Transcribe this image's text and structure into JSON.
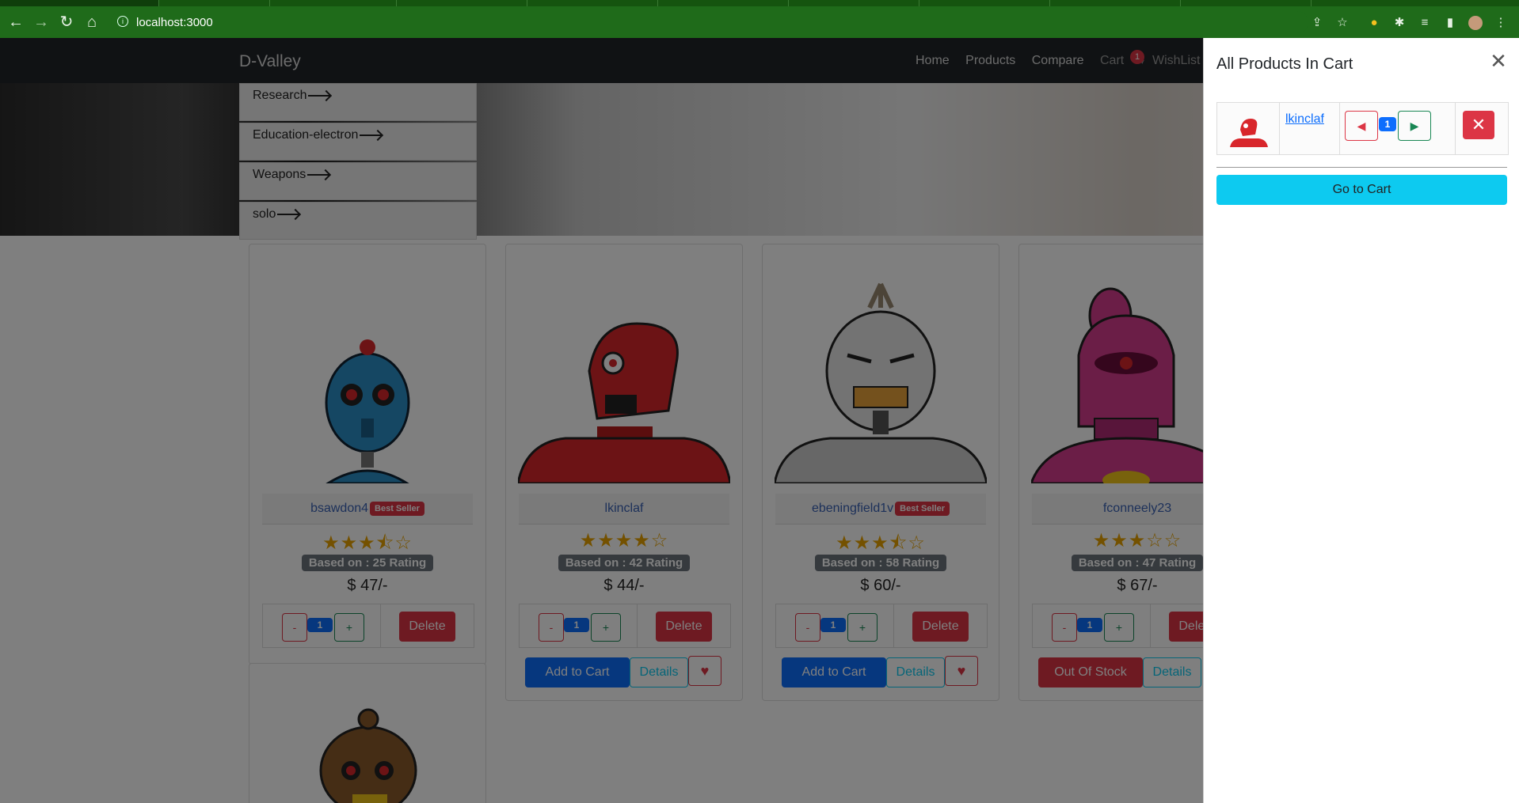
{
  "browser": {
    "url": "localhost:3000",
    "chrome_color": "#1f6b1a"
  },
  "navbar": {
    "brand": "D-Valley",
    "links": [
      "Home",
      "Products",
      "Compare"
    ],
    "cart_label": "Cart",
    "cart_count": "1",
    "wishlist_label": "WishList"
  },
  "categories": [
    "Research",
    "Education-electron",
    "Weapons",
    "solo"
  ],
  "products": [
    {
      "name": "bsawdon4",
      "best_seller": true,
      "stars": "★★★⯪☆",
      "rating_text": "Based on : 25 Rating",
      "price": "$ 47/-",
      "qty": "1",
      "minus": "-",
      "plus": "+",
      "delete": "Delete",
      "robot_color": "#2a8fc7"
    },
    {
      "name": "lkinclaf",
      "best_seller": false,
      "stars": "★★★★☆",
      "rating_text": "Based on : 42 Rating",
      "price": "$ 44/-",
      "qty": "1",
      "minus": "-",
      "plus": "+",
      "delete": "Delete",
      "action": "Add to Cart",
      "details": "Details",
      "robot_color": "#d8262b"
    },
    {
      "name": "ebeningfield1v",
      "best_seller": true,
      "stars": "★★★⯪☆",
      "rating_text": "Based on : 58 Rating",
      "price": "$ 60/-",
      "qty": "1",
      "minus": "-",
      "plus": "+",
      "delete": "Delete",
      "action": "Add to Cart",
      "details": "Details",
      "robot_color": "#d9d9d9"
    },
    {
      "name": "fconneely23",
      "best_seller": false,
      "stars": "★★★☆☆",
      "rating_text": "Based on : 47 Rating",
      "price": "$ 67/-",
      "qty": "1",
      "minus": "-",
      "plus": "+",
      "delete": "Delete",
      "action": "Out Of Stock",
      "details": "Details",
      "robot_color": "#d63d8e"
    }
  ],
  "best_seller_label": "Best Seller",
  "cart_drawer": {
    "title": "All Products In Cart",
    "item_name": "lkinclaf",
    "item_qty": "1",
    "go_to_cart": "Go to Cart"
  }
}
